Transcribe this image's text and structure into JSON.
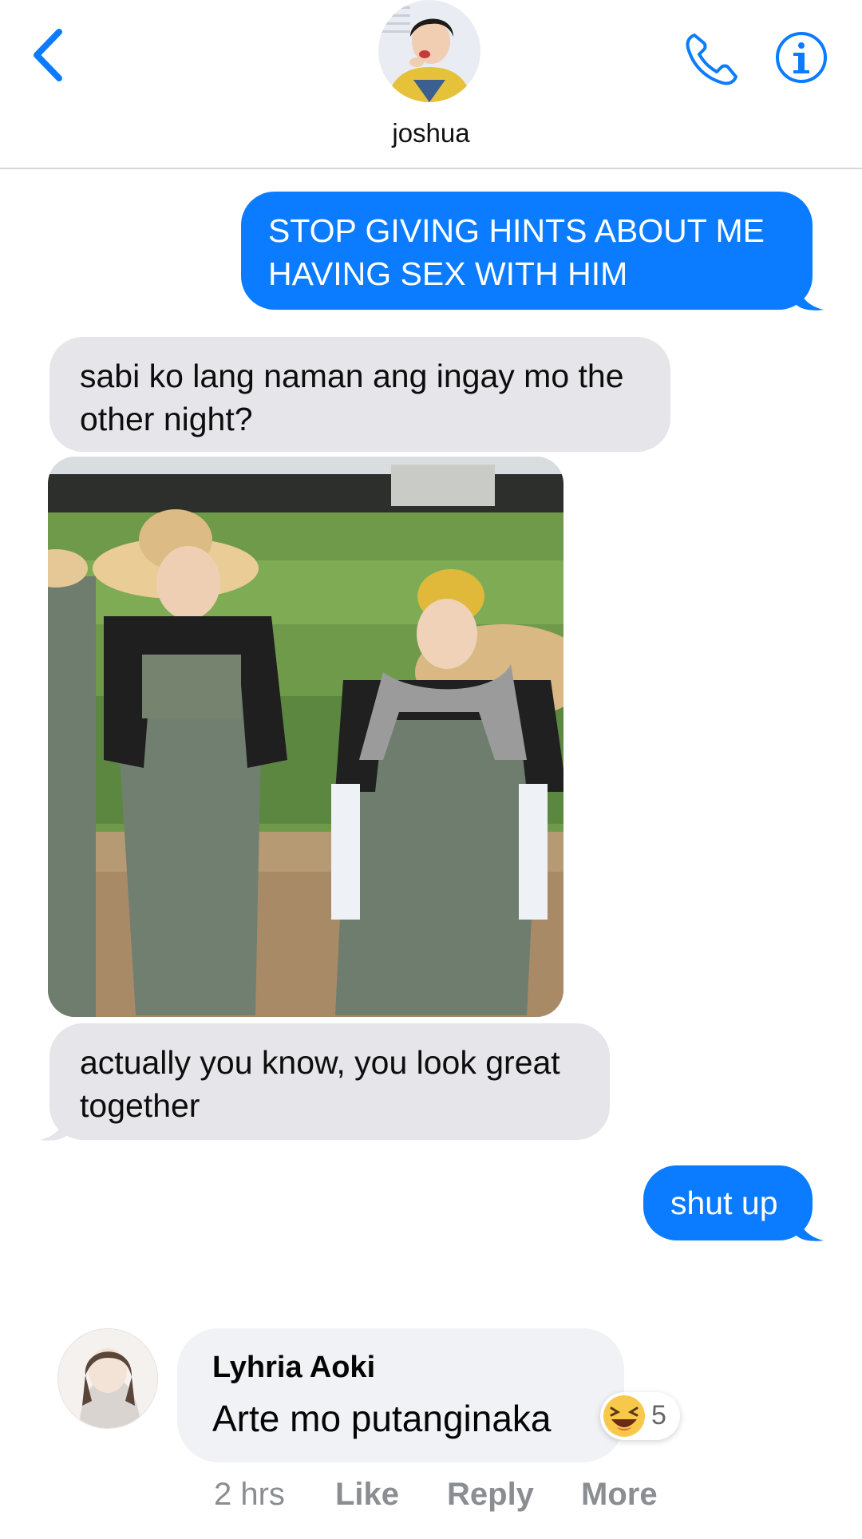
{
  "header": {
    "contact_name": "joshua",
    "back_icon": "chevron-left-icon",
    "call_icon": "phone-icon",
    "info_icon": "info-icon",
    "accent_color": "#0b7cff"
  },
  "messages": [
    {
      "side": "out",
      "text_lines": [
        "STOP GIVING HINTS ABOUT ME",
        "HAVING SEX WITH HIM"
      ]
    },
    {
      "side": "in",
      "text_lines": [
        "sabi ko lang naman ang ingay mo the",
        "other night?"
      ]
    },
    {
      "side": "in",
      "type": "photo"
    },
    {
      "side": "in",
      "text_lines": [
        "actually you know, you look great",
        "together"
      ]
    },
    {
      "side": "out",
      "text_lines": [
        "shut up"
      ]
    }
  ],
  "comment": {
    "author": "Lyhria Aoki",
    "text": "Arte mo putanginaka",
    "reaction_icon": "laughing-emoji-icon",
    "reaction_count": "5",
    "time": "2 hrs",
    "like_label": "Like",
    "reply_label": "Reply",
    "more_label": "More"
  }
}
